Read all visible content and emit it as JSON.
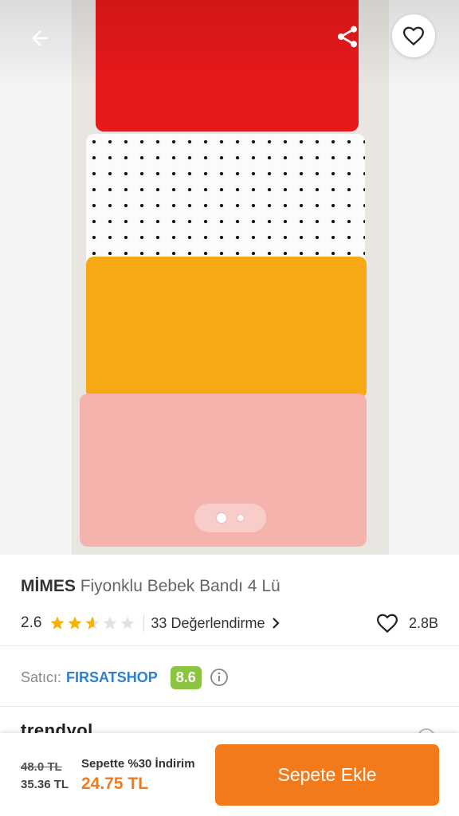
{
  "product": {
    "brand": "MİMES",
    "name": "Fiyonklu Bebek Bandı 4 Lü",
    "rating": 2.6,
    "rating_text": "2.6",
    "review_text": "33 Değerlendirme",
    "likes_text": "2.8B",
    "image_pager": {
      "count": 2,
      "active": 1
    }
  },
  "seller": {
    "label": "Satıcı:",
    "name": "FIRSATSHOP",
    "score": "8.6"
  },
  "peek_text": "trendyol",
  "pricing": {
    "original": "48.0 TL",
    "previous": "35.36 TL",
    "cart_discount": "Sepette %30 İndirim",
    "final": "24.75 TL"
  },
  "actions": {
    "add_to_cart": "Sepete Ekle"
  },
  "icons": {
    "back": "arrow-left-icon",
    "share": "share-icon",
    "favorite": "heart-outline-icon",
    "info": "info-icon",
    "chevron": "chevron-right-icon"
  },
  "colors": {
    "accent": "#f27a1a",
    "star": "#f6b300",
    "seller_link": "#2f80d1",
    "seller_score_bg": "#8bc53f"
  }
}
